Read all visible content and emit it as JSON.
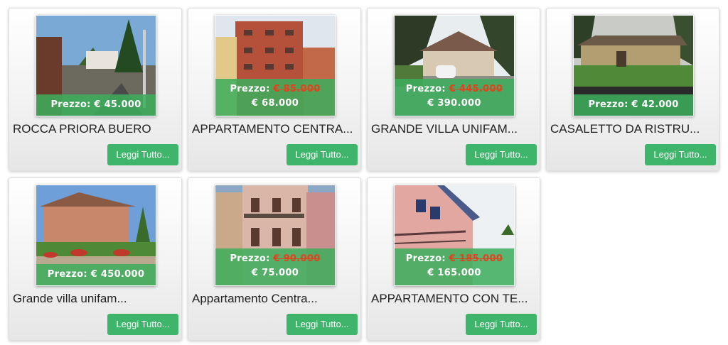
{
  "colors": {
    "accent": "#3fb56b",
    "price_band": "#3cae5c",
    "old_price": "#e3421e"
  },
  "listings": [
    {
      "image_icon": "house-photo",
      "price_label": "Prezzo: € 45.000",
      "title": "ROCCA PRIORA BUERO",
      "button_label": "Leggi Tutto..."
    },
    {
      "image_icon": "apartment-photo",
      "price_prefix": "Prezzo:",
      "old_price": "€ 85.000",
      "new_price": "€ 68.000",
      "title": "APPARTAMENTO CENTRA...",
      "button_label": "Leggi Tutto..."
    },
    {
      "image_icon": "villa-photo",
      "price_prefix": "Prezzo:",
      "old_price": "€ 445.000",
      "new_price": "€ 390.000",
      "title": "GRANDE VILLA UNIFAM...",
      "button_label": "Leggi Tutto..."
    },
    {
      "image_icon": "farmhouse-photo",
      "price_label": "Prezzo: € 42.000",
      "title": "CASALETTO DA RISTRU...",
      "button_label": "Leggi Tutto..."
    },
    {
      "image_icon": "villa-garden-photo",
      "price_label": "Prezzo: € 450.000",
      "title": "Grande villa unifam...",
      "button_label": "Leggi Tutto..."
    },
    {
      "image_icon": "pink-building-photo",
      "price_prefix": "Prezzo:",
      "old_price": "€ 90.000",
      "new_price": "€ 75.000",
      "title": "Appartamento Centra...",
      "button_label": "Leggi Tutto..."
    },
    {
      "image_icon": "terrace-building-photo",
      "price_prefix": "Prezzo:",
      "old_price": "€ 185.000",
      "new_price": "€ 165.000",
      "title": "APPARTAMENTO CON TE...",
      "button_label": "Leggi Tutto..."
    }
  ]
}
